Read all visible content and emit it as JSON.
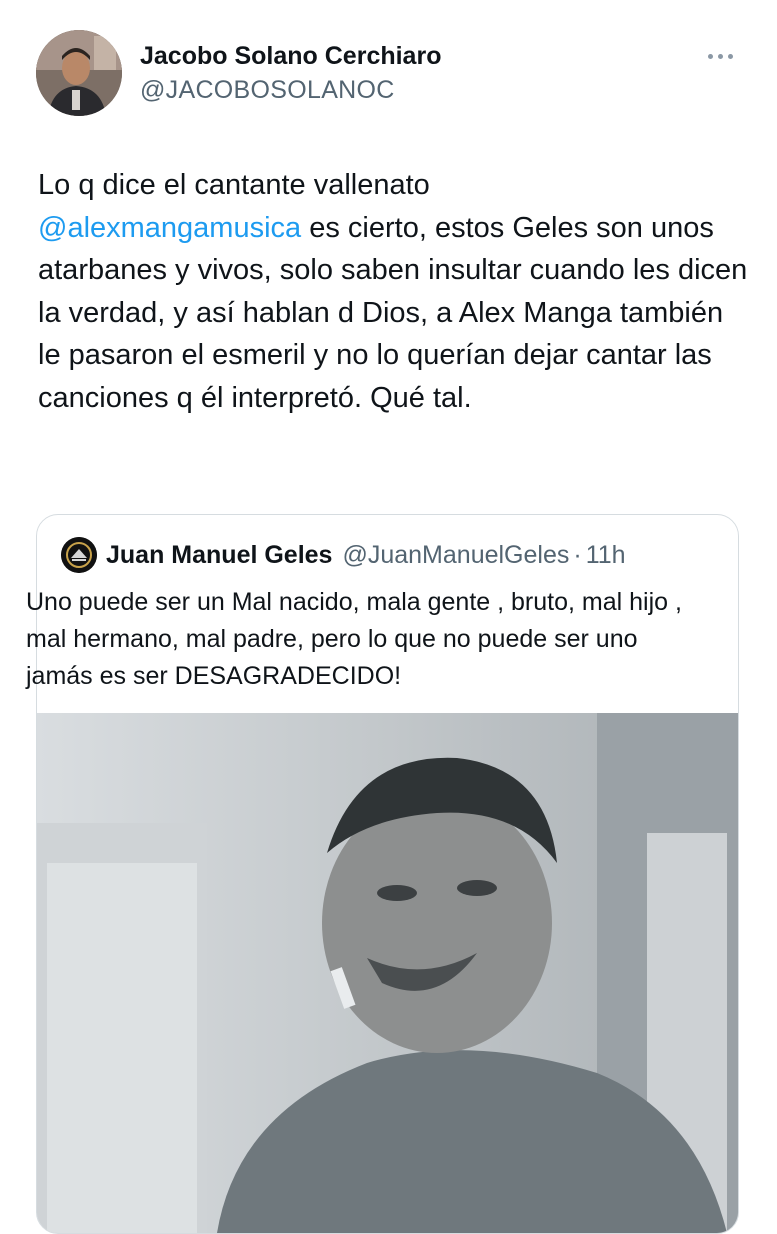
{
  "tweet": {
    "author": {
      "display_name": "Jacobo Solano Cerchiaro",
      "handle": "@JACOBOSOLANOC"
    },
    "more_icon": "more-horizontal-icon",
    "text_before_mention": "Lo q dice el cantante vallenato\n",
    "mention": "@alexmangamusica",
    "text_after_mention": " es cierto, estos Geles son unos atarbanes y vivos, solo saben insultar cuando les dicen la verdad, y así hablan d Dios, a Alex Manga también le pasaron el esmeril y no lo querían dejar cantar las canciones q él interpretó. Qué tal.",
    "quoted_tweet": {
      "display_name": "Juan Manuel Geles",
      "handle": "@JuanManuelGeles",
      "separator": "·",
      "time": "11h",
      "text": "Uno puede ser un Mal nacido, mala gente , bruto, mal hijo , mal hermano, mal padre, pero lo que no puede ser uno jamás es ser DESAGRADECIDO!"
    }
  },
  "colors": {
    "text": "#0f1419",
    "secondary": "#536471",
    "link": "#1d9bf0",
    "border": "#d6dce0"
  }
}
